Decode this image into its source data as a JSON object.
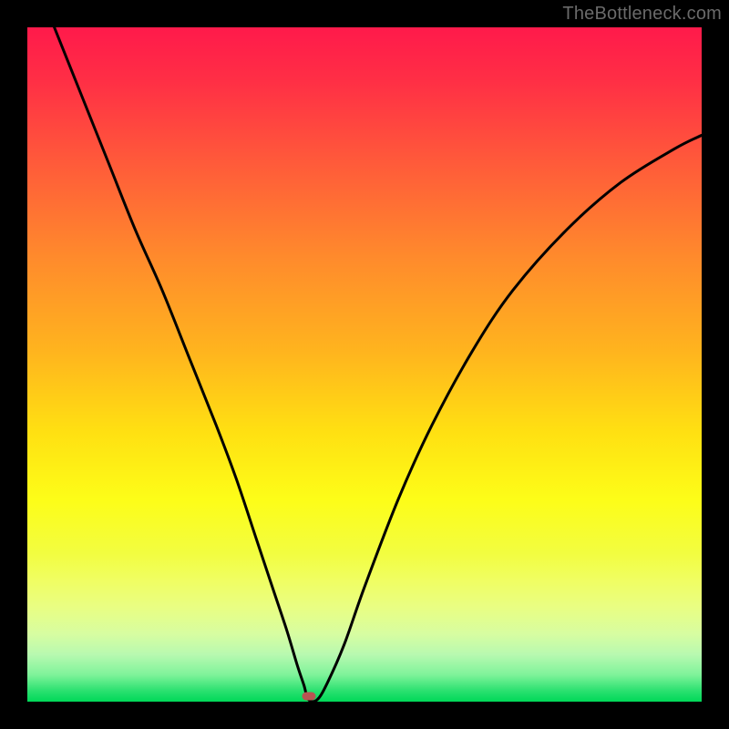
{
  "watermark": "TheBottleneck.com",
  "plot": {
    "marker": {
      "x_frac": 0.417,
      "y_frac": 0.992
    }
  },
  "chart_data": {
    "type": "line",
    "title": "",
    "xlabel": "",
    "ylabel": "",
    "xlim": [
      0,
      1
    ],
    "ylim": [
      0,
      1
    ],
    "legend": false,
    "grid": false,
    "background": "rainbow-gradient red→green top→bottom",
    "note": "No axis ticks or numeric labels are rendered; the curve depicts a V-shaped bottleneck profile dipping to ~0 near x≈0.42, asymmetric with steeper left side. Values below are visually estimated fractions of the plot area (0=left/bottom, 1=right/top).",
    "series": [
      {
        "name": "bottleneck-curve",
        "x": [
          0.04,
          0.08,
          0.12,
          0.16,
          0.2,
          0.24,
          0.28,
          0.31,
          0.34,
          0.365,
          0.385,
          0.4,
          0.41,
          0.417,
          0.43,
          0.445,
          0.47,
          0.5,
          0.55,
          0.6,
          0.66,
          0.72,
          0.8,
          0.88,
          0.96,
          1.0
        ],
        "y": [
          1.0,
          0.9,
          0.8,
          0.7,
          0.61,
          0.51,
          0.41,
          0.33,
          0.24,
          0.165,
          0.105,
          0.055,
          0.025,
          0.003,
          0.003,
          0.028,
          0.085,
          0.17,
          0.3,
          0.41,
          0.52,
          0.61,
          0.7,
          0.77,
          0.82,
          0.84
        ]
      }
    ],
    "marker": {
      "shape": "rounded-rect",
      "color": "#b85452",
      "x": 0.417,
      "y": 0.003
    }
  }
}
